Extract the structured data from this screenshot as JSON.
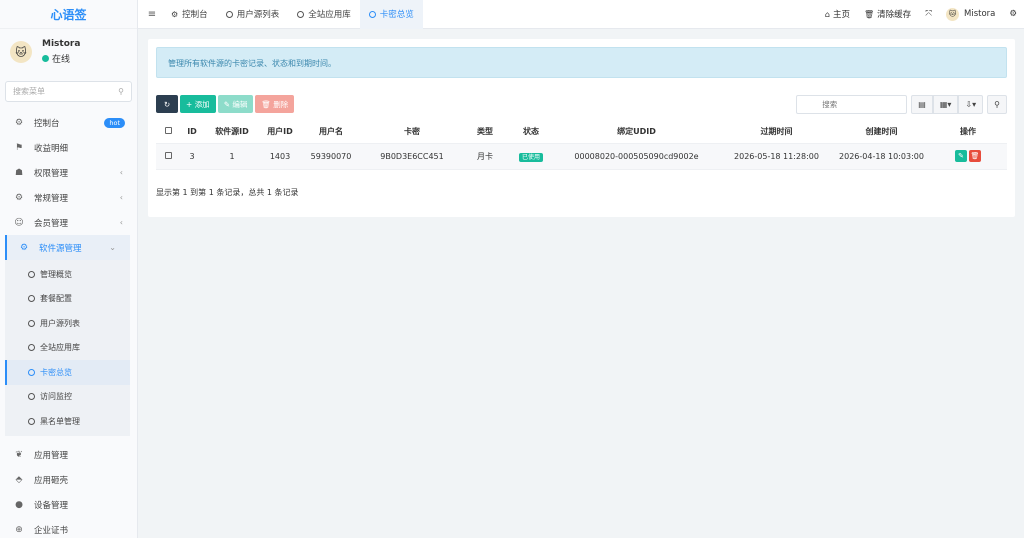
{
  "app": {
    "logo": "心语签"
  },
  "user": {
    "name": "Mistora",
    "status": "在线"
  },
  "sidebar": {
    "search_placeholder": "搜索菜单",
    "items": [
      {
        "label": "控制台",
        "icon": "dashboard-icon",
        "badge": "hot"
      },
      {
        "label": "收益明细",
        "icon": "flag-icon"
      },
      {
        "label": "权限管理",
        "icon": "group-icon",
        "arrow": "‹"
      },
      {
        "label": "常规管理",
        "icon": "cogs-icon",
        "arrow": "‹"
      },
      {
        "label": "会员管理",
        "icon": "user-icon",
        "arrow": "‹"
      },
      {
        "label": "软件源管理",
        "icon": "dashboard-icon",
        "arrow": "⌄"
      }
    ],
    "sub_items": [
      {
        "label": "管理概览"
      },
      {
        "label": "套餐配置"
      },
      {
        "label": "用户源列表"
      },
      {
        "label": "全站应用库"
      },
      {
        "label": "卡密总览"
      },
      {
        "label": "访问监控"
      },
      {
        "label": "黑名单管理"
      }
    ],
    "bottom_items": [
      {
        "label": "应用管理",
        "icon": "leaf-icon"
      },
      {
        "label": "应用砸壳",
        "icon": "shell-icon"
      },
      {
        "label": "设备管理",
        "icon": "circle-icon"
      },
      {
        "label": "企业证书",
        "icon": "certificate-icon"
      }
    ]
  },
  "topbar": {
    "tabs": [
      {
        "label": "控制台",
        "icon": "dashboard-icon"
      },
      {
        "label": "用户源列表",
        "icon": "circle-icon"
      },
      {
        "label": "全站应用库",
        "icon": "circle-icon"
      },
      {
        "label": "卡密总览",
        "icon": "circle-icon"
      }
    ],
    "home": "主页",
    "clear_cache": "清除缓存",
    "user": "Mistora"
  },
  "main": {
    "alert": "管理所有软件源的卡密记录、状态和到期时间。",
    "toolbar": {
      "add": "添加",
      "edit": "编辑",
      "delete": "删除"
    },
    "search_placeholder": "搜索",
    "columns": [
      "ID",
      "软件源ID",
      "用户ID",
      "用户名",
      "卡密",
      "类型",
      "状态",
      "绑定UDID",
      "过期时间",
      "创建时间",
      "操作"
    ],
    "rows": [
      {
        "id": "3",
        "source_id": "1",
        "user_id": "1403",
        "username": "59390070",
        "card": "9B0D3E6CC451",
        "type": "月卡",
        "status": "已使用",
        "udid": "00008020-000505090cd9002e",
        "expire": "2026-05-18 11:28:00",
        "created": "2026-04-18 10:03:00"
      }
    ],
    "pager": "显示第 1 到第 1 条记录，总共 1 条记录"
  },
  "colors": {
    "accent": "#2c8ef8",
    "success": "#18bc9c",
    "danger": "#e74c3c",
    "dark": "#2c3e50"
  }
}
